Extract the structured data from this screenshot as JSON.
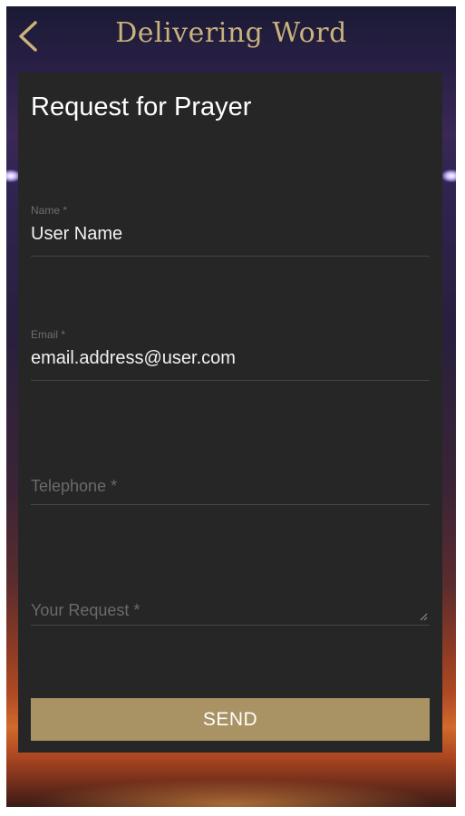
{
  "header": {
    "title": "Delivering Word",
    "back_icon": "chevron-left-icon",
    "accent_color": "#c9b27c"
  },
  "form": {
    "title": "Request for Prayer",
    "fields": [
      {
        "label": "Name *",
        "value": "User Name"
      },
      {
        "label": "Email *",
        "value": "email.address@user.com"
      },
      {
        "placeholder": "Telephone *",
        "value": ""
      },
      {
        "placeholder": "Your Request *",
        "value": ""
      }
    ],
    "send_label": "SEND",
    "send_color": "#a99364",
    "card_color": "#262626"
  }
}
